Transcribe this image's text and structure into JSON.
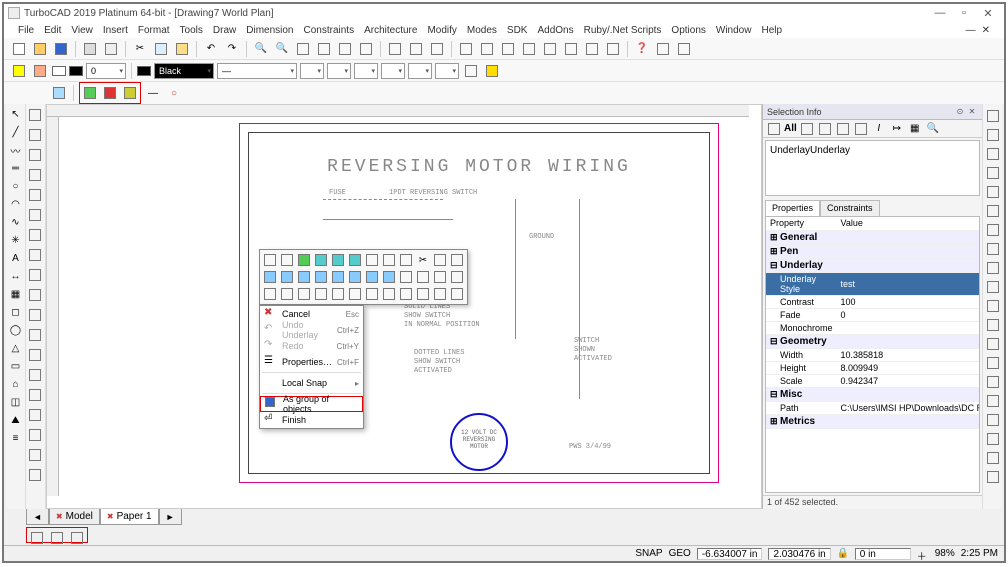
{
  "window": {
    "title": "TurboCAD 2019 Platinum 64-bit - [Drawing7 World Plan]",
    "min": "—",
    "max": "▫",
    "close": "✕",
    "inner_min": "—",
    "inner_close": "✕"
  },
  "menu": [
    "File",
    "Edit",
    "View",
    "Insert",
    "Format",
    "Tools",
    "Draw",
    "Dimension",
    "Constraints",
    "Architecture",
    "Modify",
    "Modes",
    "SDK",
    "AddOns",
    "Ruby/.Net Scripts",
    "Options",
    "Window",
    "Help"
  ],
  "toolbar2": {
    "color1": "#ffffff",
    "num": "0",
    "layer_color": "#000000",
    "layer_name": "Black",
    "linetype": "—"
  },
  "canvas": {
    "drawing_title": "REVERSING MOTOR WIRING",
    "labels": {
      "fuse": "FUSE",
      "switch_main": "1PDT REVERSING SWITCH",
      "ground": "GROUND",
      "solid_lines": "SOLID LINES\nSHOW SWITCH\nIN NORMAL POSITION",
      "dotted_lines": "DOTTED LINES\nSHOW SWITCH\nACTIVATED",
      "switch_shown": "SWITCH\nSHOWN\nACTIVATED",
      "motor": "12 VOLT DC\nREVERSING\nMOTOR",
      "signature": "PWS   3/4/99"
    },
    "tabs": {
      "model": "Model",
      "paper": "Paper 1"
    }
  },
  "context_menu": {
    "cancel": {
      "label": "Cancel",
      "shortcut": "Esc"
    },
    "undo": {
      "label": "Undo Underlay",
      "shortcut": "Ctrl+Z"
    },
    "redo": {
      "label": "Redo",
      "shortcut": "Ctrl+Y"
    },
    "props": {
      "label": "Properties…",
      "shortcut": "Ctrl+F"
    },
    "localsnap": {
      "label": "Local Snap"
    },
    "asgroup": {
      "label": "As group of objects"
    },
    "finish": {
      "label": "Finish"
    }
  },
  "panel": {
    "title": "Selection Info",
    "toolbar_text": "All",
    "tree_item": "Underlay",
    "tabs": {
      "properties": "Properties",
      "constraints": "Constraints"
    },
    "headers": {
      "property": "Property",
      "value": "Value"
    },
    "groups": {
      "general": "General",
      "pen": "Pen",
      "underlay": "Underlay",
      "geometry": "Geometry",
      "misc": "Misc",
      "metrics": "Metrics"
    },
    "rows": {
      "underlay_style": {
        "k": "Underlay Style",
        "v": "test"
      },
      "contrast": {
        "k": "Contrast",
        "v": "100"
      },
      "fade": {
        "k": "Fade",
        "v": "0"
      },
      "monochrome": {
        "k": "Monochrome",
        "v": ""
      },
      "width": {
        "k": "Width",
        "v": "10.385818"
      },
      "height": {
        "k": "Height",
        "v": "8.009949"
      },
      "scale": {
        "k": "Scale",
        "v": "0.942347"
      },
      "path": {
        "k": "Path",
        "v": "C:\\Users\\IMSI HP\\Downloads\\DC REVER!"
      }
    },
    "status": "1 of 452 selected."
  },
  "statusbar": {
    "snap": "SNAP",
    "geo": "GEO",
    "x": "-6.634007 in",
    "y": "2.030476 in",
    "dist": "0 in",
    "zoom": "98%",
    "time": "2:25 PM"
  }
}
